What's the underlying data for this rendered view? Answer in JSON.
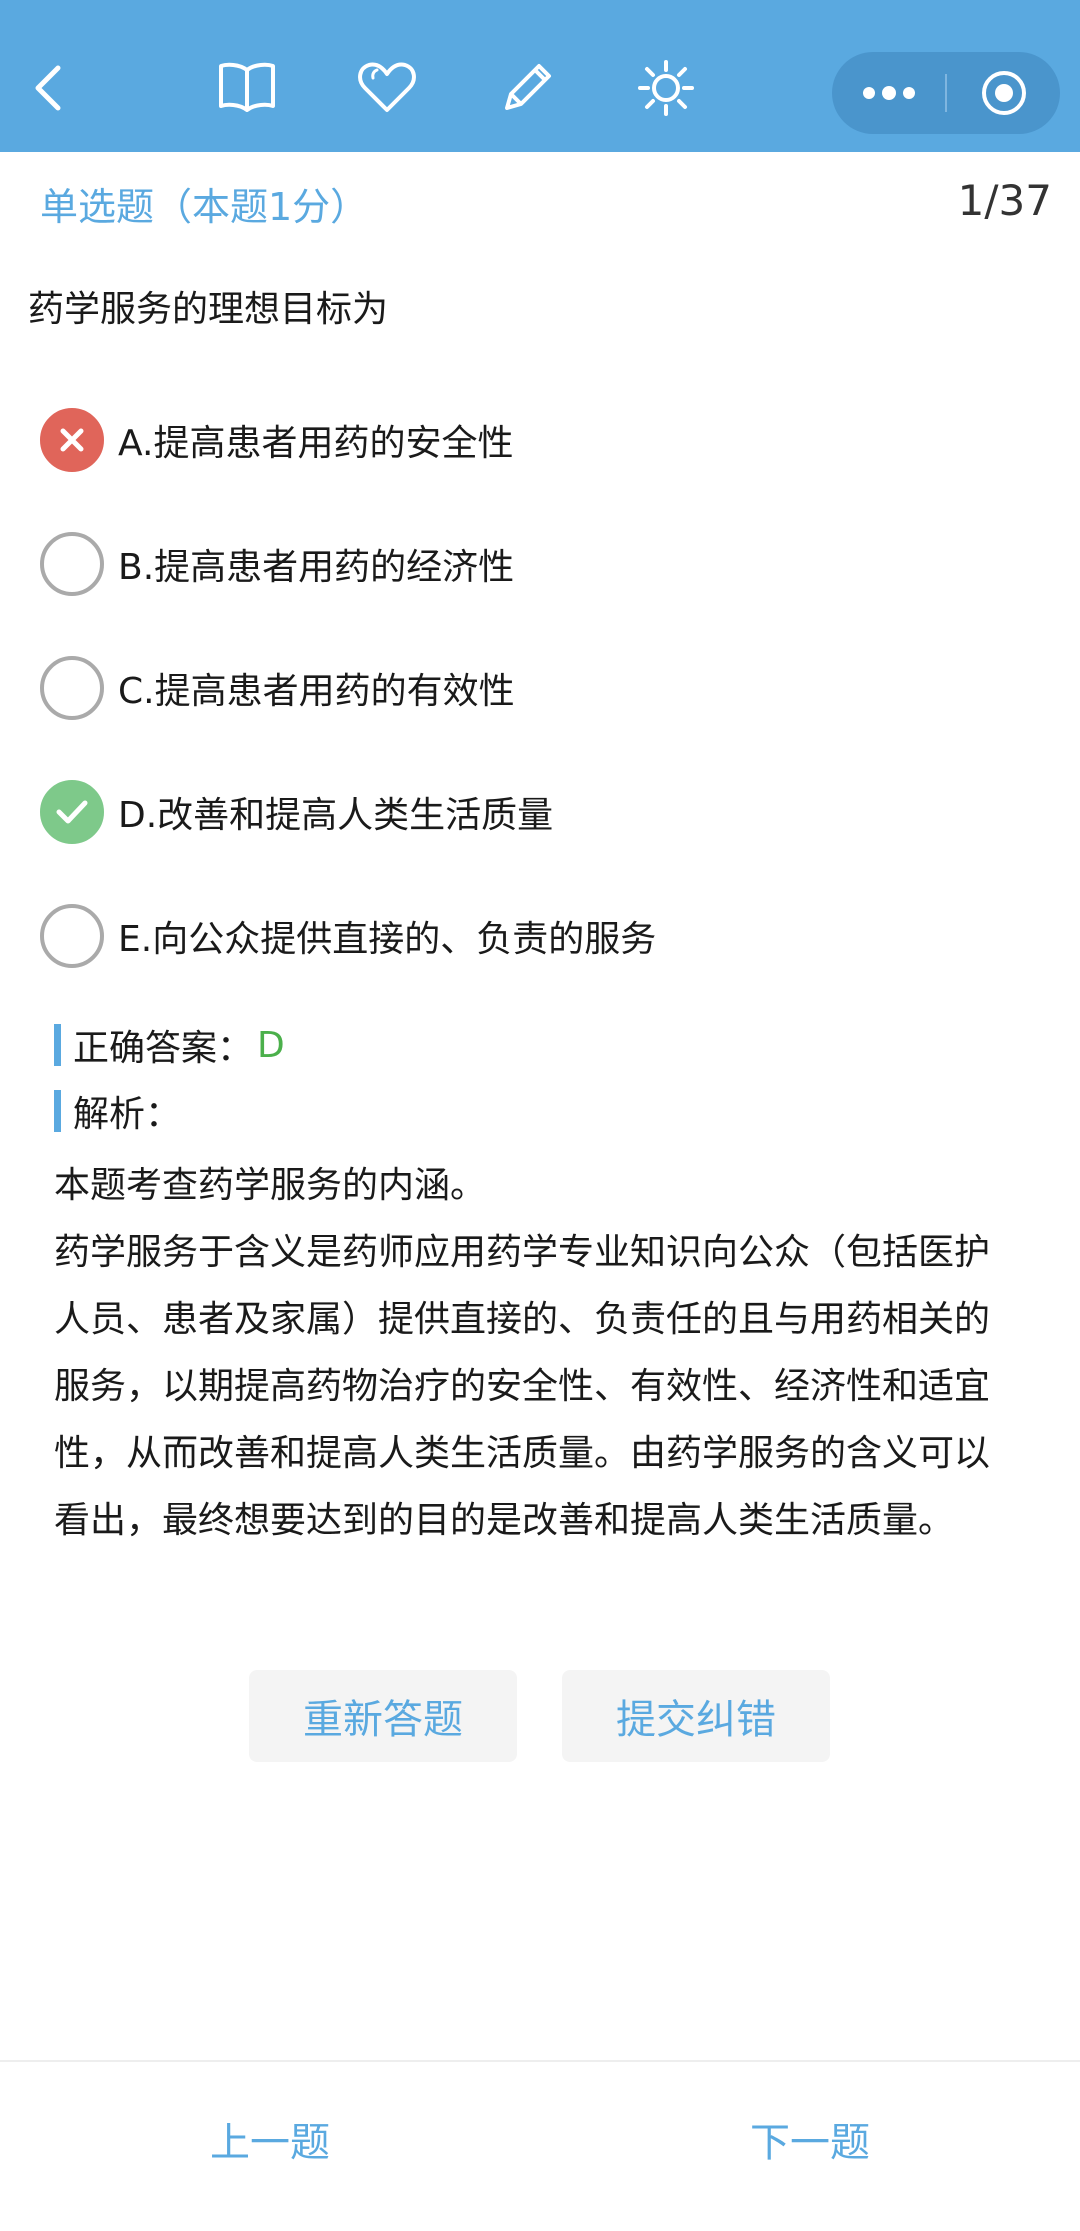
{
  "toolbar": {
    "icons": [
      "back-icon",
      "book-icon",
      "heart-icon",
      "pencil-icon",
      "brightness-icon"
    ],
    "capsule": [
      "more-icon",
      "target-icon"
    ],
    "color": "#5aa9e0"
  },
  "question": {
    "type_label": "单选题（本题1分）",
    "progress": "1/37",
    "stem": "药学服务的理想目标为"
  },
  "options": [
    {
      "text": "A.提高患者用药的安全性",
      "state": "wrong"
    },
    {
      "text": "B.提高患者用药的经济性",
      "state": "none"
    },
    {
      "text": "C.提高患者用药的有效性",
      "state": "none"
    },
    {
      "text": "D.改善和提高人类生活质量",
      "state": "correct"
    },
    {
      "text": "E.向公众提供直接的、负责的服务",
      "state": "none"
    }
  ],
  "analysis": {
    "correct_label": "正确答案：",
    "correct_value": "D",
    "analysis_label": "解析：",
    "line1": "本题考查药学服务的内涵。",
    "line2": "药学服务于含义是药师应用药学专业知识向公众（包括医护人员、患者及家属）提供直接的、负责任的且与用药相关的服务，以期提高药物治疗的安全性、有效性、经济性和适宜性，从而改善和提高人类生活质量。由药学服务的含义可以看出，最终想要达到的目的是改善和提高人类生活质量。"
  },
  "actions": {
    "redo": "重新答题",
    "report": "提交纠错"
  },
  "nav": {
    "prev": "上一题",
    "next": "下一题"
  },
  "colors": {
    "accent": "#5aa9e0",
    "wrong": "#e0655a",
    "correct": "#7ec98a",
    "answer_text": "#4bb04b"
  }
}
